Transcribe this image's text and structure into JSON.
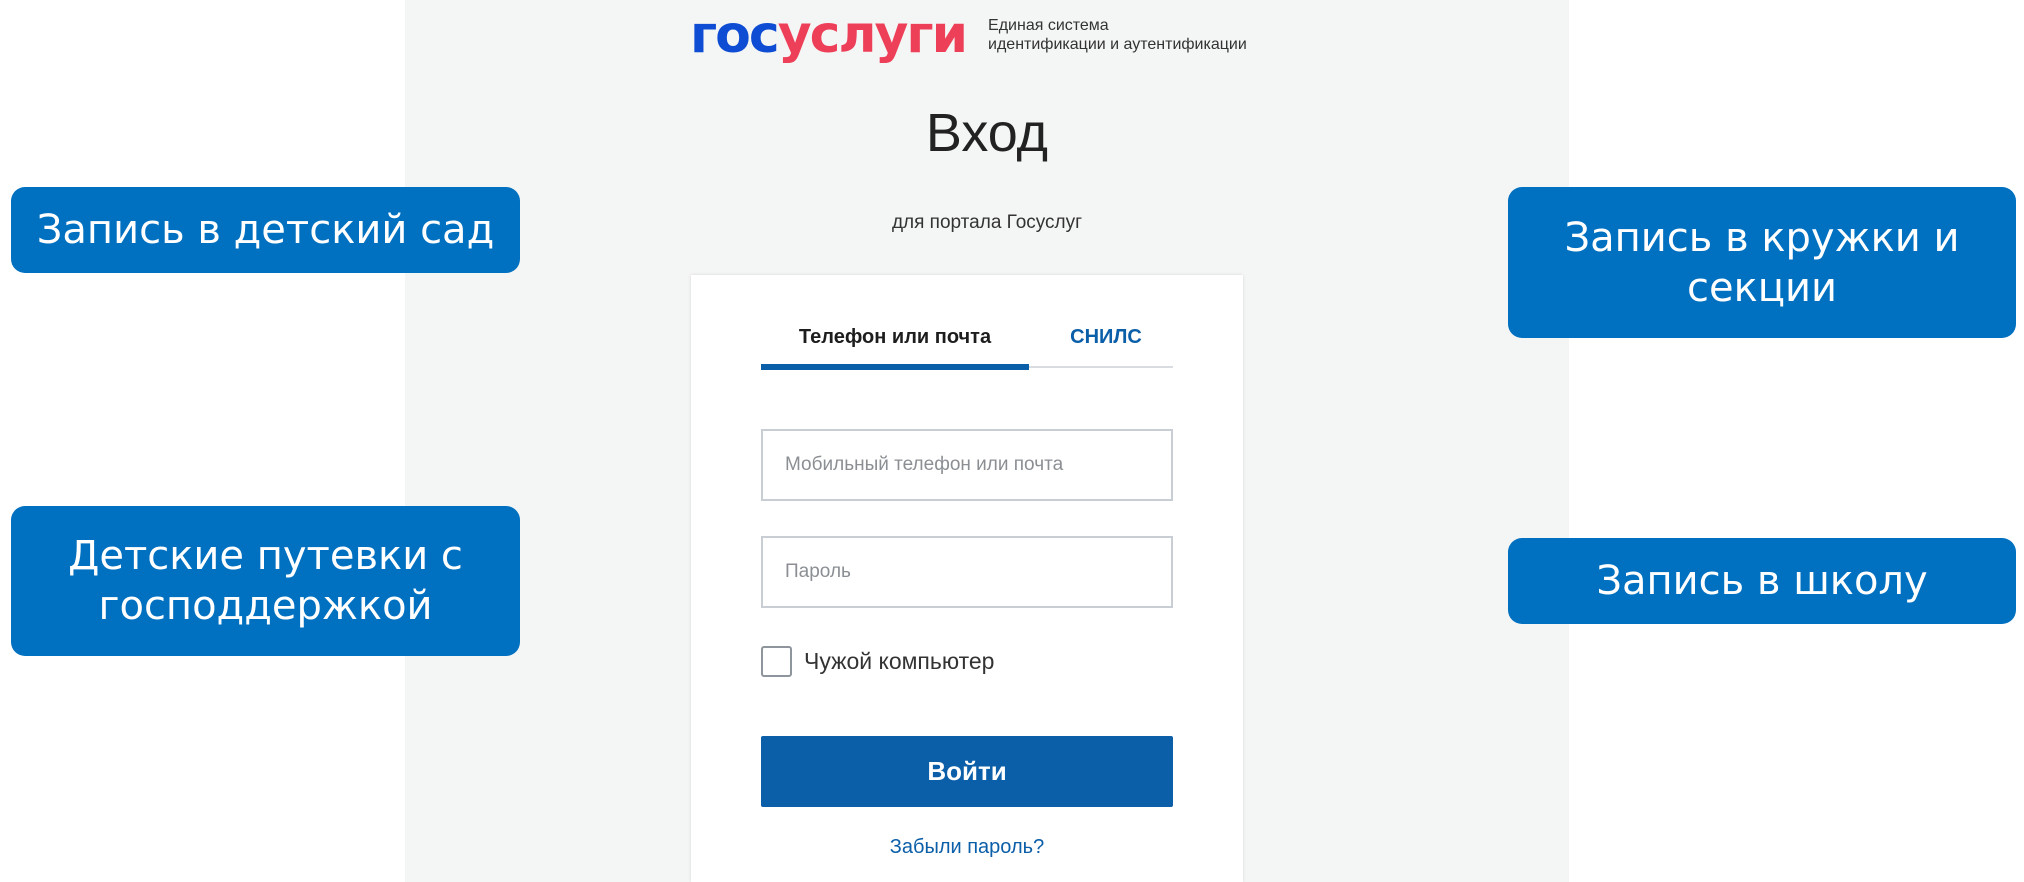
{
  "logo": {
    "gos": "гос",
    "uslugi": "услуги",
    "subtitle_line1": "Единая система",
    "subtitle_line2": "идентификации и аутентификации"
  },
  "page": {
    "title": "Вход",
    "subtitle": "для портала Госуслуг"
  },
  "login": {
    "tabs": [
      {
        "label": "Телефон или почта",
        "active": true
      },
      {
        "label": "СНИЛС",
        "active": false
      }
    ],
    "login_field": {
      "placeholder": "Мобильный телефон или почта",
      "value": ""
    },
    "password_field": {
      "placeholder": "Пароль",
      "value": ""
    },
    "foreign_computer_label": "Чужой компьютер",
    "foreign_computer_checked": false,
    "submit_label": "Войти",
    "forgot_label": "Забыли пароль?"
  },
  "callouts": {
    "kindergarten": "Запись в детский сад",
    "vouchers": "Детские путевки с господдержкой",
    "clubs": "Запись в кружки и секции",
    "school": "Запись в школу"
  },
  "colors": {
    "primary": "#0b5ea8",
    "callout": "#0070c0",
    "logo_blue": "#0d4cd3",
    "logo_red": "#ee3f58"
  }
}
